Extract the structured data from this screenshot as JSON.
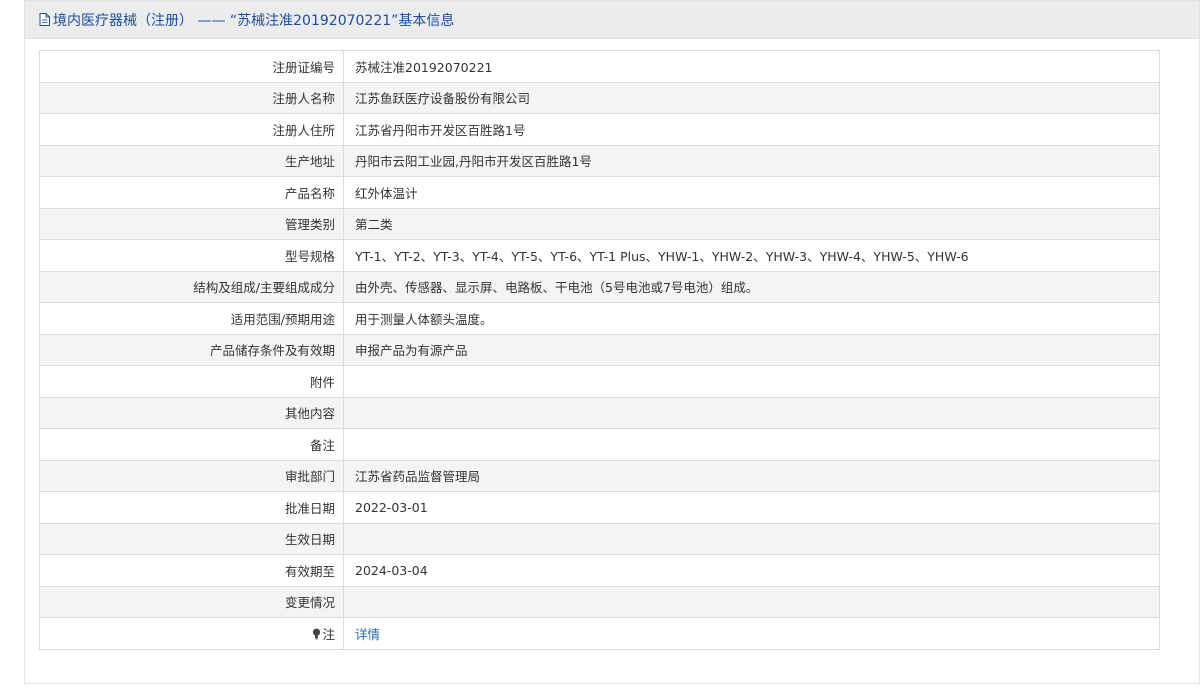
{
  "header": {
    "title": "境内医疗器械（注册） ——  “苏械注准20192070221”基本信息"
  },
  "rows": [
    {
      "label": "注册证编号",
      "value": "苏械注准20192070221"
    },
    {
      "label": "注册人名称",
      "value": "江苏鱼跃医疗设备股份有限公司"
    },
    {
      "label": "注册人住所",
      "value": "江苏省丹阳市开发区百胜路1号"
    },
    {
      "label": "生产地址",
      "value": "丹阳市云阳工业园,丹阳市开发区百胜路1号"
    },
    {
      "label": "产品名称",
      "value": "红外体温计"
    },
    {
      "label": "管理类别",
      "value": "第二类"
    },
    {
      "label": "型号规格",
      "value": "YT-1、YT-2、YT-3、YT-4、YT-5、YT-6、YT-1 Plus、YHW-1、YHW-2、YHW-3、YHW-4、YHW-5、YHW-6"
    },
    {
      "label": "结构及组成/主要组成成分",
      "value": "由外壳、传感器、显示屏、电路板、干电池（5号电池或7号电池）组成。"
    },
    {
      "label": "适用范围/预期用途",
      "value": "用于测量人体额头温度。"
    },
    {
      "label": "产品储存条件及有效期",
      "value": "申报产品为有源产品"
    },
    {
      "label": "附件",
      "value": ""
    },
    {
      "label": "其他内容",
      "value": ""
    },
    {
      "label": "备注",
      "value": ""
    },
    {
      "label": "审批部门",
      "value": "江苏省药品监督管理局"
    },
    {
      "label": "批准日期",
      "value": "2022-03-01"
    },
    {
      "label": "生效日期",
      "value": ""
    },
    {
      "label": "有效期至",
      "value": "2024-03-04"
    },
    {
      "label": "变更情况",
      "value": ""
    }
  ],
  "note": {
    "label": "注",
    "link_text": "详情",
    "icon": "bulb-icon"
  },
  "colors": {
    "header_text": "#1c4ea3",
    "link": "#1c6bb9"
  }
}
